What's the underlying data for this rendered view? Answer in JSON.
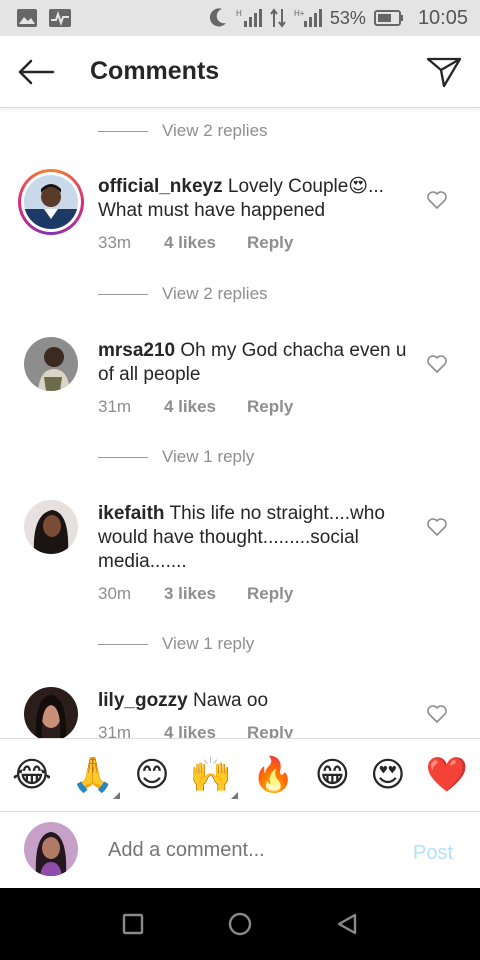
{
  "status_bar": {
    "battery_percent": "53%",
    "time": "10:05",
    "icons": [
      "gallery-icon",
      "activity-icon",
      "moon-icon",
      "signal-h-icon",
      "data-arrows-icon",
      "signal-h-plus-icon",
      "battery-icon"
    ]
  },
  "header": {
    "title": "Comments",
    "back_icon": "arrow-left-icon",
    "send_icon": "paper-plane-icon"
  },
  "comments": [
    {
      "view_replies_above": "View 2 replies"
    },
    {
      "username": "official_nkeyz",
      "text": "Lovely Couple😍... What must have happened",
      "time": "33m",
      "likes": "4 likes",
      "reply": "Reply",
      "view_replies": "View 2 replies",
      "story_ring": true
    },
    {
      "username": "mrsa210",
      "text": "Oh my God chacha even u of all people",
      "time": "31m",
      "likes": "4 likes",
      "reply": "Reply",
      "view_replies": "View 1 reply"
    },
    {
      "username": "ikefaith",
      "text": "This life no straight....who would have thought.........social media.......",
      "time": "30m",
      "likes": "3 likes",
      "reply": "Reply",
      "view_replies": "View 1 reply"
    },
    {
      "username": "lily_gozzy",
      "text": "Nawa oo",
      "time": "31m",
      "likes": "4 likes",
      "reply": "Reply"
    }
  ],
  "emoji_bar": [
    {
      "char": "😂",
      "name": "tears-of-joy-emoji",
      "has_variants": false
    },
    {
      "char": "🙏",
      "name": "folded-hands-emoji",
      "has_variants": true
    },
    {
      "char": "😊",
      "name": "smiling-face-emoji",
      "has_variants": false
    },
    {
      "char": "🙌",
      "name": "raising-hands-emoji",
      "has_variants": true
    },
    {
      "char": "🔥",
      "name": "fire-emoji",
      "has_variants": false
    },
    {
      "char": "😁",
      "name": "beaming-face-emoji",
      "has_variants": false
    },
    {
      "char": "😍",
      "name": "heart-eyes-emoji",
      "has_variants": false
    },
    {
      "char": "❤️",
      "name": "red-heart-emoji",
      "has_variants": false
    }
  ],
  "composer": {
    "placeholder": "Add a comment...",
    "post_label": "Post"
  },
  "nav_bar": {
    "icons": [
      "recents-square-icon",
      "home-circle-icon",
      "back-triangle-icon"
    ]
  },
  "colors": {
    "text": "#262626",
    "secondary": "#8e8e8e",
    "post_disabled": "#b2dffc",
    "status_bar_bg": "#e4e4e4",
    "nav_bar_bg": "#000000"
  }
}
